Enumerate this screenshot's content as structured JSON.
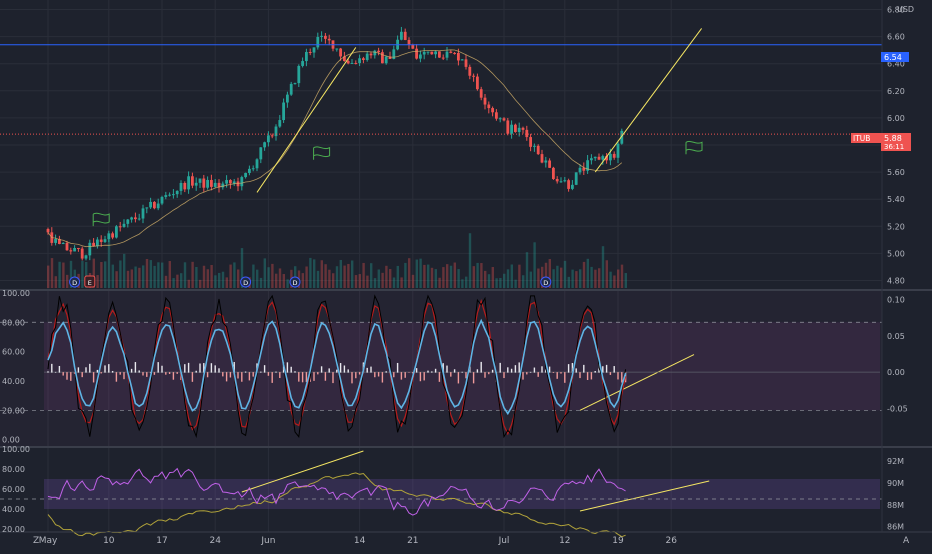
{
  "colors": {
    "background": "#1e222d",
    "grid": "#2a2e39",
    "text": "#b2b5be",
    "up": "#26a69a",
    "down": "#ef5350",
    "hline_blue": "#2962ff",
    "trendline": "#f5e663",
    "stoch_k": "#000000",
    "stoch_d": "#b71c1c",
    "stoch_light": "#5fb4e5",
    "rsi": "#c061e8",
    "volume_line": "#b0a23a"
  },
  "header": {
    "currency": "USD"
  },
  "x_axis": {
    "labels": [
      "May",
      "10",
      "17",
      "24",
      "Jun",
      "14",
      "21",
      "Jul",
      "12",
      "19",
      "26"
    ],
    "left_corner": "Z",
    "right_corner": "A"
  },
  "markers": {
    "dividend": "D",
    "earnings": "E"
  },
  "chart_data": [
    {
      "type": "candlestick",
      "symbol": "ITUB",
      "last_price": "5.88",
      "countdown": "36:11",
      "horizontal_line_label": "6.54",
      "horizontal_line": 6.54,
      "y_ticks": [
        "6.80",
        "6.60",
        "6.40",
        "6.20",
        "6.00",
        "5.80",
        "5.60",
        "5.40",
        "5.20",
        "5.00",
        "4.80"
      ],
      "ylim": [
        4.73,
        6.87
      ],
      "trend_days": [
        0,
        2,
        5,
        8,
        12,
        16,
        19,
        23,
        26,
        30,
        32,
        34,
        36,
        38,
        40,
        43,
        45,
        47,
        49,
        51,
        53,
        55,
        57,
        59,
        61,
        63,
        65,
        67,
        69,
        71,
        73,
        75,
        76
      ],
      "trend_prices": [
        5.18,
        5.05,
        5.0,
        5.12,
        5.26,
        5.42,
        5.53,
        5.5,
        5.53,
        5.88,
        6.15,
        6.43,
        6.58,
        6.55,
        6.4,
        6.48,
        6.42,
        6.62,
        6.45,
        6.5,
        6.47,
        6.45,
        6.22,
        6.05,
        5.92,
        5.9,
        5.75,
        5.58,
        5.51,
        5.63,
        5.71,
        5.72,
        5.88
      ],
      "trendlines": [
        {
          "from": [
            27.5,
            5.45
          ],
          "to": [
            40.5,
            6.52
          ]
        },
        {
          "from": [
            72,
            5.6
          ],
          "to": [
            86,
            6.66
          ]
        }
      ],
      "dividend_days": [
        3.5,
        26,
        32.5,
        65.5
      ],
      "earnings_days": [
        5.5
      ]
    },
    {
      "type": "line",
      "name": "stochastic",
      "y_ticks": [
        "100.00",
        "80.00",
        "60.00",
        "40.00",
        "20.00",
        "0.00"
      ],
      "ylim": [
        -5,
        102
      ],
      "right_ticks": [
        "0.10",
        "0.05",
        "0.00",
        "-0.05"
      ],
      "right_ylim": [
        -0.103,
        0.113
      ],
      "levels": [
        80,
        20
      ],
      "trendline": {
        "from": [
          70,
          20
        ],
        "to": [
          85,
          58
        ]
      }
    },
    {
      "type": "line",
      "name": "rsi",
      "y_ticks": [
        "100.00",
        "80.00",
        "60.00",
        "40.00",
        "20.00"
      ],
      "ylim": [
        17,
        102
      ],
      "right_ticks": [
        "92M",
        "90M",
        "88M",
        "86M"
      ],
      "right_ylim": [
        85.5,
        93.3
      ],
      "band": [
        40,
        70
      ],
      "level": 50,
      "trendlines": [
        {
          "from": [
            25.5,
            57
          ],
          "to": [
            41.5,
            98
          ]
        },
        {
          "from": [
            70,
            38
          ],
          "to": [
            87,
            68
          ]
        }
      ]
    }
  ]
}
